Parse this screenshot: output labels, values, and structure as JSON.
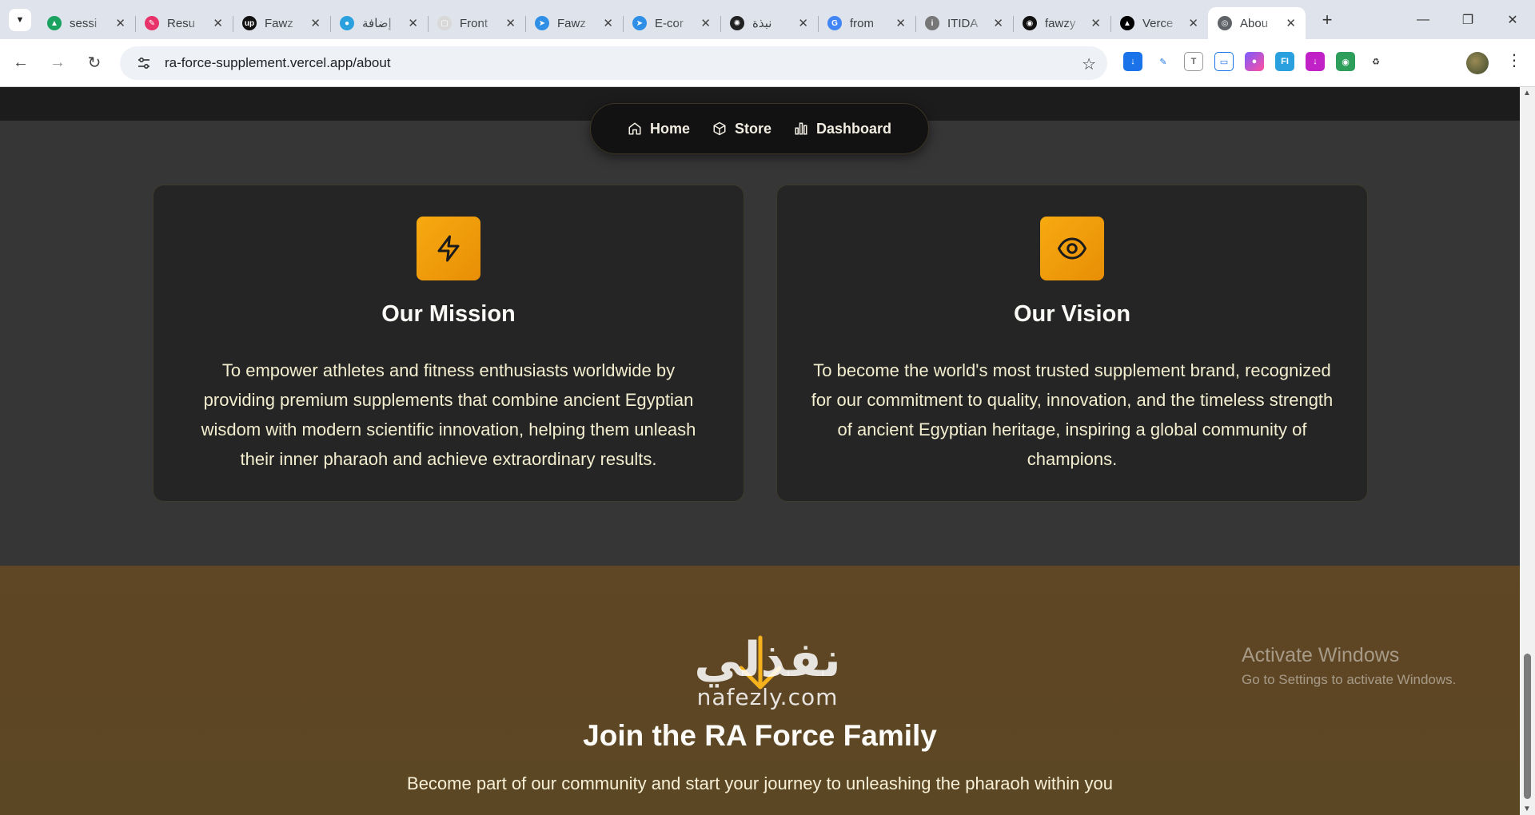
{
  "browser": {
    "tabs": [
      {
        "title": "sessi",
        "icon": "google-drive-icon",
        "color": "#1aa260"
      },
      {
        "title": "Resu",
        "icon": "pen-nib-icon",
        "color": "#e8336a"
      },
      {
        "title": "Fawz",
        "icon": "upwork-icon",
        "color": "#111111"
      },
      {
        "title": "إضافة",
        "icon": "circle-app-icon",
        "color": "#2aa1de"
      },
      {
        "title": "Front",
        "icon": "page-icon",
        "color": "#d8d8d8"
      },
      {
        "title": "Fawz",
        "icon": "paper-plane-icon",
        "color": "#2f8fe6"
      },
      {
        "title": "E-cor",
        "icon": "paper-plane-icon",
        "color": "#2f8fe6"
      },
      {
        "title": "نبذة",
        "icon": "openai-icon",
        "color": "#222222"
      },
      {
        "title": "from",
        "icon": "google-icon",
        "color": "#4285f4"
      },
      {
        "title": "ITIDA",
        "icon": "itida-icon",
        "color": "#777777"
      },
      {
        "title": "fawzy",
        "icon": "github-icon",
        "color": "#111111"
      },
      {
        "title": "Verce",
        "icon": "vercel-icon",
        "color": "#000000"
      },
      {
        "title": "Abou",
        "icon": "globe-icon",
        "color": "#5f6368",
        "active": true
      }
    ],
    "url": "ra-force-supplement.vercel.app/about"
  },
  "nav": {
    "home": "Home",
    "store": "Store",
    "dashboard": "Dashboard"
  },
  "mission": {
    "icon": "lightning-icon",
    "title": "Our Mission",
    "text": "To empower athletes and fitness enthusiasts worldwide by providing premium supplements that combine ancient Egyptian wisdom with modern scientific innovation, helping them unleash their inner pharaoh and achieve extraordinary results."
  },
  "vision": {
    "icon": "eye-icon",
    "title": "Our Vision",
    "text": "To become the world's most trusted supplement brand, recognized for our commitment to quality, innovation, and the timeless strength of ancient Egyptian heritage, inspiring a global community of champions."
  },
  "join": {
    "title": "Join the RA Force Family",
    "subtitle": "Become part of our community and start your journey to unleashing the pharaoh within you"
  },
  "overlay": {
    "watermark_arabic": "نفذلي",
    "watermark_latin": "nafezly.com",
    "activate_title": "Activate Windows",
    "activate_sub": "Go to Settings to activate Windows."
  },
  "colors": {
    "accent": "#f4a20c",
    "card_bg": "#252525",
    "page_bg": "#363636",
    "join_bg": "#5f4625"
  }
}
